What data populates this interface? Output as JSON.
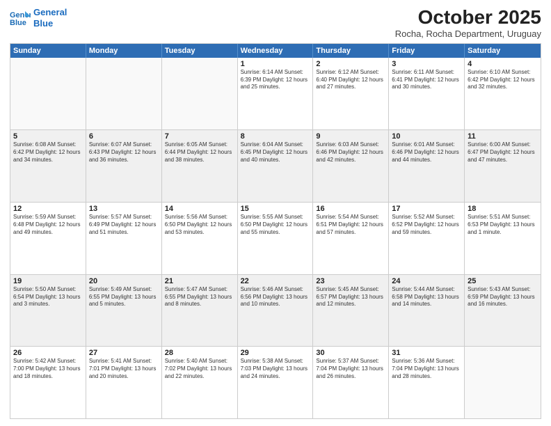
{
  "logo": {
    "line1": "General",
    "line2": "Blue"
  },
  "title": "October 2025",
  "subtitle": "Rocha, Rocha Department, Uruguay",
  "weekdays": [
    "Sunday",
    "Monday",
    "Tuesday",
    "Wednesday",
    "Thursday",
    "Friday",
    "Saturday"
  ],
  "rows": [
    [
      {
        "day": "",
        "info": ""
      },
      {
        "day": "",
        "info": ""
      },
      {
        "day": "",
        "info": ""
      },
      {
        "day": "1",
        "info": "Sunrise: 6:14 AM\nSunset: 6:39 PM\nDaylight: 12 hours\nand 25 minutes."
      },
      {
        "day": "2",
        "info": "Sunrise: 6:12 AM\nSunset: 6:40 PM\nDaylight: 12 hours\nand 27 minutes."
      },
      {
        "day": "3",
        "info": "Sunrise: 6:11 AM\nSunset: 6:41 PM\nDaylight: 12 hours\nand 30 minutes."
      },
      {
        "day": "4",
        "info": "Sunrise: 6:10 AM\nSunset: 6:42 PM\nDaylight: 12 hours\nand 32 minutes."
      }
    ],
    [
      {
        "day": "5",
        "info": "Sunrise: 6:08 AM\nSunset: 6:42 PM\nDaylight: 12 hours\nand 34 minutes."
      },
      {
        "day": "6",
        "info": "Sunrise: 6:07 AM\nSunset: 6:43 PM\nDaylight: 12 hours\nand 36 minutes."
      },
      {
        "day": "7",
        "info": "Sunrise: 6:05 AM\nSunset: 6:44 PM\nDaylight: 12 hours\nand 38 minutes."
      },
      {
        "day": "8",
        "info": "Sunrise: 6:04 AM\nSunset: 6:45 PM\nDaylight: 12 hours\nand 40 minutes."
      },
      {
        "day": "9",
        "info": "Sunrise: 6:03 AM\nSunset: 6:46 PM\nDaylight: 12 hours\nand 42 minutes."
      },
      {
        "day": "10",
        "info": "Sunrise: 6:01 AM\nSunset: 6:46 PM\nDaylight: 12 hours\nand 44 minutes."
      },
      {
        "day": "11",
        "info": "Sunrise: 6:00 AM\nSunset: 6:47 PM\nDaylight: 12 hours\nand 47 minutes."
      }
    ],
    [
      {
        "day": "12",
        "info": "Sunrise: 5:59 AM\nSunset: 6:48 PM\nDaylight: 12 hours\nand 49 minutes."
      },
      {
        "day": "13",
        "info": "Sunrise: 5:57 AM\nSunset: 6:49 PM\nDaylight: 12 hours\nand 51 minutes."
      },
      {
        "day": "14",
        "info": "Sunrise: 5:56 AM\nSunset: 6:50 PM\nDaylight: 12 hours\nand 53 minutes."
      },
      {
        "day": "15",
        "info": "Sunrise: 5:55 AM\nSunset: 6:50 PM\nDaylight: 12 hours\nand 55 minutes."
      },
      {
        "day": "16",
        "info": "Sunrise: 5:54 AM\nSunset: 6:51 PM\nDaylight: 12 hours\nand 57 minutes."
      },
      {
        "day": "17",
        "info": "Sunrise: 5:52 AM\nSunset: 6:52 PM\nDaylight: 12 hours\nand 59 minutes."
      },
      {
        "day": "18",
        "info": "Sunrise: 5:51 AM\nSunset: 6:53 PM\nDaylight: 13 hours\nand 1 minute."
      }
    ],
    [
      {
        "day": "19",
        "info": "Sunrise: 5:50 AM\nSunset: 6:54 PM\nDaylight: 13 hours\nand 3 minutes."
      },
      {
        "day": "20",
        "info": "Sunrise: 5:49 AM\nSunset: 6:55 PM\nDaylight: 13 hours\nand 5 minutes."
      },
      {
        "day": "21",
        "info": "Sunrise: 5:47 AM\nSunset: 6:55 PM\nDaylight: 13 hours\nand 8 minutes."
      },
      {
        "day": "22",
        "info": "Sunrise: 5:46 AM\nSunset: 6:56 PM\nDaylight: 13 hours\nand 10 minutes."
      },
      {
        "day": "23",
        "info": "Sunrise: 5:45 AM\nSunset: 6:57 PM\nDaylight: 13 hours\nand 12 minutes."
      },
      {
        "day": "24",
        "info": "Sunrise: 5:44 AM\nSunset: 6:58 PM\nDaylight: 13 hours\nand 14 minutes."
      },
      {
        "day": "25",
        "info": "Sunrise: 5:43 AM\nSunset: 6:59 PM\nDaylight: 13 hours\nand 16 minutes."
      }
    ],
    [
      {
        "day": "26",
        "info": "Sunrise: 5:42 AM\nSunset: 7:00 PM\nDaylight: 13 hours\nand 18 minutes."
      },
      {
        "day": "27",
        "info": "Sunrise: 5:41 AM\nSunset: 7:01 PM\nDaylight: 13 hours\nand 20 minutes."
      },
      {
        "day": "28",
        "info": "Sunrise: 5:40 AM\nSunset: 7:02 PM\nDaylight: 13 hours\nand 22 minutes."
      },
      {
        "day": "29",
        "info": "Sunrise: 5:38 AM\nSunset: 7:03 PM\nDaylight: 13 hours\nand 24 minutes."
      },
      {
        "day": "30",
        "info": "Sunrise: 5:37 AM\nSunset: 7:04 PM\nDaylight: 13 hours\nand 26 minutes."
      },
      {
        "day": "31",
        "info": "Sunrise: 5:36 AM\nSunset: 7:04 PM\nDaylight: 13 hours\nand 28 minutes."
      },
      {
        "day": "",
        "info": ""
      }
    ]
  ]
}
